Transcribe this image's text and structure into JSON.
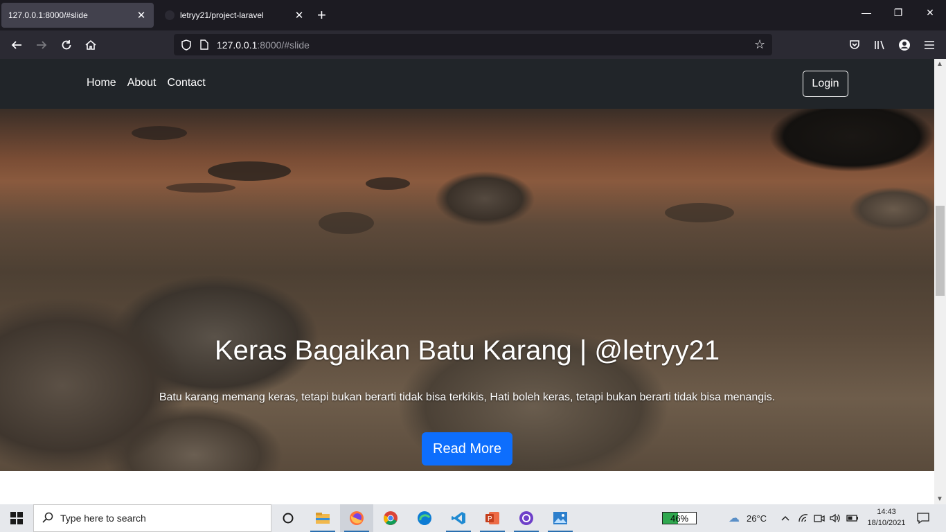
{
  "browser": {
    "tabs": [
      {
        "title": "127.0.0.1:8000/#slide",
        "active": true
      },
      {
        "title": "letryy21/project-laravel",
        "active": false
      }
    ],
    "url_host": "127.0.0.1",
    "url_rest": ":8000/#slide"
  },
  "site": {
    "nav_links": [
      "Home",
      "About",
      "Contact"
    ],
    "login_label": "Login",
    "hero_title": "Keras Bagaikan Batu Karang | @letryy21",
    "hero_text": "Batu karang memang keras, tetapi bukan berarti tidak bisa terkikis, Hati boleh keras, tetapi bukan berarti tidak bisa menangis.",
    "cta_label": "Read More",
    "accent_color": "#0d6efd",
    "navbar_color": "#212529"
  },
  "taskbar": {
    "search_placeholder": "Type here to search",
    "apps": [
      "cortana-icon",
      "file-explorer-icon",
      "firefox-icon",
      "chrome-icon",
      "edge-icon",
      "vscode-icon",
      "powerpoint-icon",
      "github-desktop-icon",
      "photos-icon"
    ],
    "battery_percent": "46%",
    "battery_level": 0.46,
    "temperature": "26°C",
    "time": "14:43",
    "date": "18/10/2021"
  }
}
